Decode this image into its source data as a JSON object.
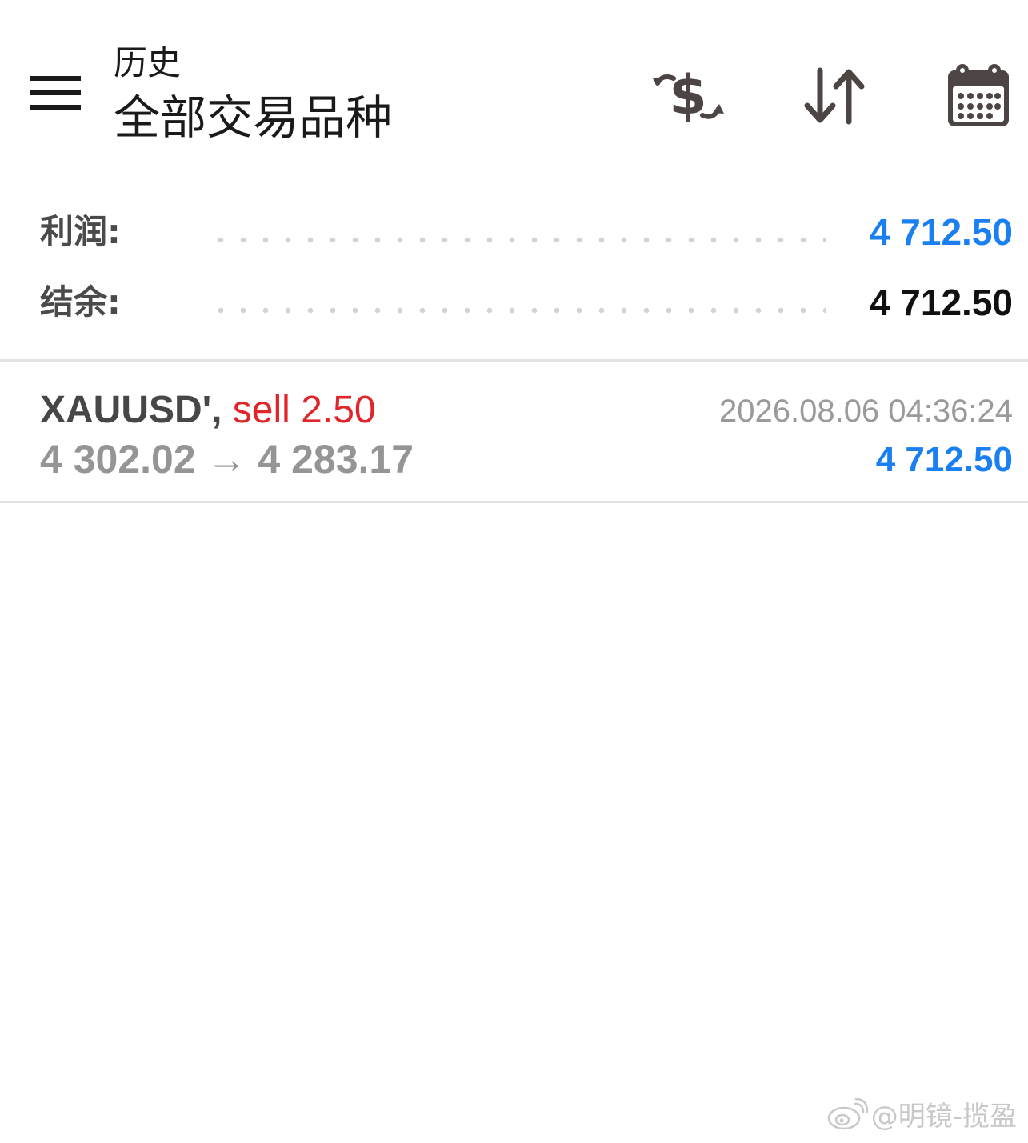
{
  "header": {
    "menu_icon": "hamburger-menu-icon",
    "title_small": "历史",
    "title_large": "全部交易品种",
    "toolbar_icons": [
      "dollar-exchange-icon",
      "sort-icon",
      "calendar-icon"
    ]
  },
  "summary": {
    "profit_label": "利润:",
    "profit_value": "4 712.50",
    "balance_label": "结余:",
    "balance_value": "4 712.50"
  },
  "trades": [
    {
      "symbol": "XAUUSD'",
      "separator": ",",
      "side": "sell 2.50",
      "prices": "4 302.02 → 4 283.17",
      "time": "2026.08.06 04:36:24",
      "profit": "4 712.50"
    }
  ],
  "watermark": {
    "icon": "weibo-icon",
    "text": "@明镜-揽盈"
  },
  "colors": {
    "profit_blue": "#1a7ff0",
    "sell_red": "#e0262a",
    "icon_dark": "#4d4444"
  }
}
